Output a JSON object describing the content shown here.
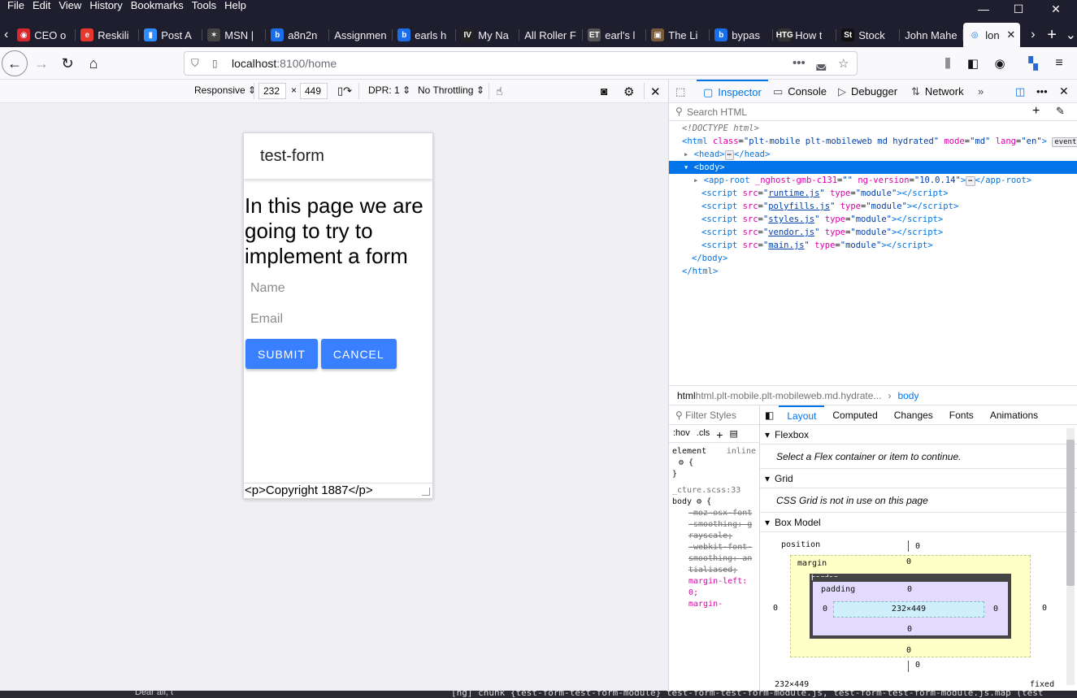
{
  "menu": [
    "File",
    "Edit",
    "View",
    "History",
    "Bookmarks",
    "Tools",
    "Help"
  ],
  "tabs": [
    {
      "label": "CEO o",
      "icon_color": "#d7282f",
      "glyph": "◉"
    },
    {
      "label": "Reskili",
      "icon_color": "#e8372d",
      "glyph": "e"
    },
    {
      "label": "Post A",
      "icon_color": "#2d8cff",
      "glyph": "▮"
    },
    {
      "label": "MSN |",
      "icon_color": "#444444",
      "glyph": "✶"
    },
    {
      "label": "a8n2n",
      "icon_color": "#1a6ee8",
      "glyph": "b"
    },
    {
      "label": "Assignmen",
      "icon_color": "",
      "glyph": ""
    },
    {
      "label": "earls h",
      "icon_color": "#1a6ee8",
      "glyph": "b"
    },
    {
      "label": "My Na",
      "icon_color": "#222222",
      "glyph": "IV"
    },
    {
      "label": "All Roller F",
      "icon_color": "",
      "glyph": ""
    },
    {
      "label": "earl's l",
      "icon_color": "#555555",
      "glyph": "ET"
    },
    {
      "label": "The Li",
      "icon_color": "#7a5a3a",
      "glyph": "▣"
    },
    {
      "label": "bypas",
      "icon_color": "#1a6ee8",
      "glyph": "b"
    },
    {
      "label": "How t",
      "icon_color": "#333333",
      "glyph": "HTG"
    },
    {
      "label": "Stock",
      "icon_color": "#111111",
      "glyph": "St"
    },
    {
      "label": "John Mahe",
      "icon_color": "",
      "glyph": ""
    },
    {
      "label": "lon",
      "icon_color": "#1a73e8",
      "glyph": "◎",
      "active": true
    }
  ],
  "url": {
    "host": "localhost",
    "path": ":8100/home"
  },
  "rdm": {
    "preset": "Responsive",
    "width": "232",
    "times": "×",
    "height": "449",
    "dpr": "DPR: 1",
    "throttling": "No Throttling"
  },
  "app": {
    "header_title": "test-form",
    "heading": "In this page we are going to try to implement a form",
    "name_placeholder": "Name",
    "email_placeholder": "Email",
    "submit_label": "SUBMIT",
    "cancel_label": "CANCEL",
    "footer": "<p>Copyright 1887</p>"
  },
  "devtools": {
    "tabs": [
      "Inspector",
      "Console",
      "Debugger",
      "Network"
    ],
    "search_placeholder": "Search HTML",
    "markup": {
      "doctype": "<!DOCTYPE html>",
      "html_class": "plt-mobile plt-mobileweb md hydrated",
      "html_mode": "md",
      "html_lang": "en",
      "event_badge": "event",
      "head_label": "head",
      "body_label": "body",
      "approot_attr1": "_nghost-gmb-c131",
      "approot_ver": "10.0.14",
      "scripts": [
        "runtime.js",
        "polyfills.js",
        "styles.js",
        "vendor.js",
        "main.js"
      ],
      "script_type": "module"
    },
    "breadcrumb_1": "html.plt-mobile.plt-mobileweb.md.hydrate...",
    "breadcrumb_2": "body",
    "rules": {
      "filter_placeholder": "Filter Styles",
      "hov": ":hov",
      "cls": ".cls",
      "element_label": "element",
      "inline_label": "inline",
      "source": "_cture.scss:33",
      "selector": "body",
      "props": [
        "-moz-osx-font-smoothing: grayscale;",
        "-webkit-font-smoothing: antialiased;"
      ],
      "prop_margin": "margin-left: 0;",
      "prop_margin2": "margin-"
    },
    "layout_tabs": [
      "Layout",
      "Computed",
      "Changes",
      "Fonts",
      "Animations"
    ],
    "flexbox_title": "Flexbox",
    "flexbox_msg": "Select a Flex container or item to continue.",
    "grid_title": "Grid",
    "grid_msg": "CSS Grid is not in use on this page",
    "boxmodel_title": "Box Model",
    "box": {
      "position": "position",
      "margin": "margin",
      "border": "border",
      "padding": "padding",
      "content": "232×449",
      "zero": "0",
      "footer_size": "232×449",
      "footer_pos": "fixed"
    }
  },
  "status": "[ng] chunk {test-form-test-form-module} test-form-test-form-module.js, test-form-test-form-module.js.map (test",
  "dear": "Dear all, t"
}
